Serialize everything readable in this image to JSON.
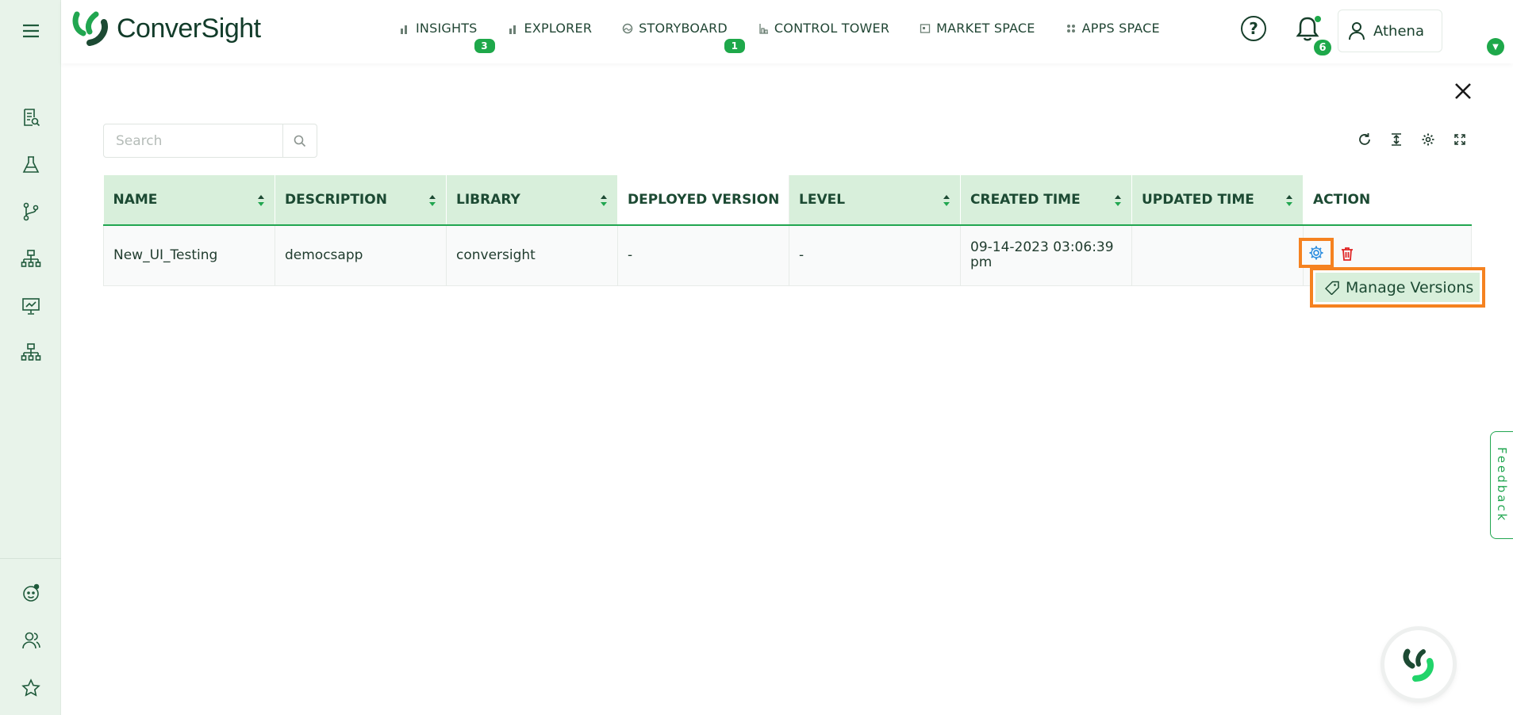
{
  "app": {
    "brand": "ConverSight",
    "accent": "#21a650",
    "highlight": "#f58220"
  },
  "nav": [
    {
      "label": "INSIGHTS",
      "icon": "bar-chart-icon",
      "badge": "3"
    },
    {
      "label": "EXPLORER",
      "icon": "bar-chart-icon",
      "badge": ""
    },
    {
      "label": "STORYBOARD",
      "icon": "storyboard-icon",
      "badge": "1"
    },
    {
      "label": "CONTROL TOWER",
      "icon": "control-tower-icon",
      "badge": ""
    },
    {
      "label": "MARKET SPACE",
      "icon": "market-space-icon",
      "badge": ""
    },
    {
      "label": "APPS SPACE",
      "icon": "apps-space-icon",
      "badge": ""
    }
  ],
  "header": {
    "help_label": "?",
    "notifications_count": "6",
    "user_name": "Athena"
  },
  "search": {
    "placeholder": "Search",
    "value": ""
  },
  "table": {
    "columns": [
      "NAME",
      "DESCRIPTION",
      "LIBRARY",
      "DEPLOYED VERSION",
      "LEVEL",
      "CREATED TIME",
      "UPDATED TIME",
      "ACTION"
    ],
    "rows": [
      {
        "name": "New_UI_Testing",
        "description": "democsapp",
        "library": "conversight",
        "deployed_version": "-",
        "level": "-",
        "created_time": "09-14-2023 03:06:39 pm",
        "updated_time": ""
      }
    ]
  },
  "popup": {
    "label": "Manage Versions"
  },
  "feedback": {
    "label": "Feedback"
  }
}
